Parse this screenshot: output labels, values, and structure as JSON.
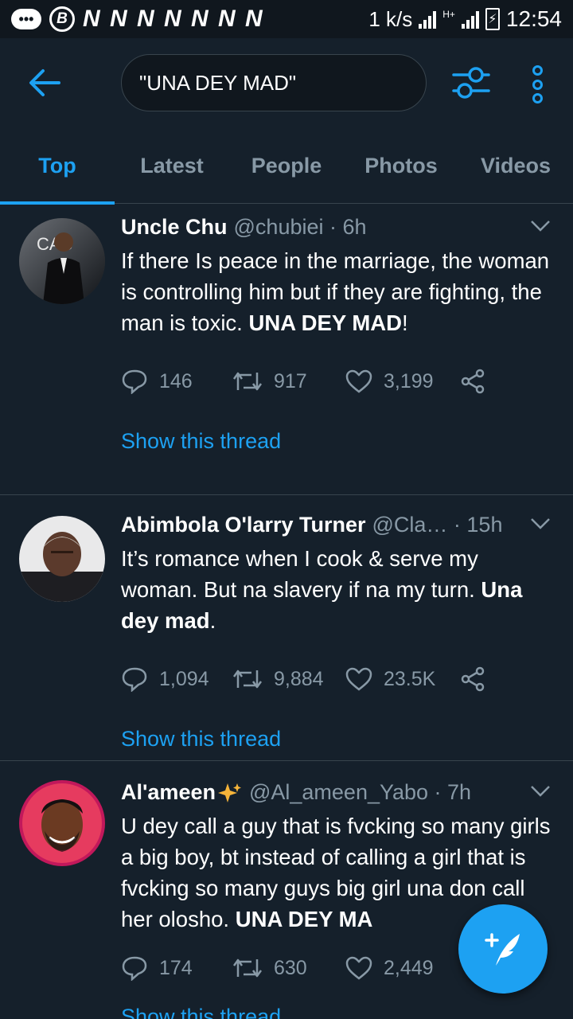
{
  "status_bar": {
    "notif_letter": "B",
    "n_icons": "N N N N N N N",
    "speed": "1 k/s",
    "network": "H+",
    "time": "12:54"
  },
  "header": {
    "search_value": "\"UNA DEY MAD\""
  },
  "tabs": [
    {
      "label": "Top",
      "active": true
    },
    {
      "label": "Latest",
      "active": false
    },
    {
      "label": "People",
      "active": false
    },
    {
      "label": "Photos",
      "active": false
    },
    {
      "label": "Videos",
      "active": false
    }
  ],
  "tweets": [
    {
      "name": "Uncle Chu",
      "handle": "@chubiei",
      "time": "6h",
      "text_before": "If there Is peace in the marriage, the woman is controlling him but if they are fighting, the man is toxic. ",
      "text_bold": "UNA DEY MAD",
      "text_after": "!",
      "replies": "146",
      "retweets": "917",
      "likes": "3,199",
      "thread_link": "Show this thread"
    },
    {
      "name": "Abimbola O'larry Turner",
      "handle": "@Cla…",
      "time": "15h",
      "text_before": "It’s romance when I cook & serve my woman. But na slavery if na my turn. ",
      "text_bold": "Una dey mad",
      "text_after": ".",
      "replies": "1,094",
      "retweets": "9,884",
      "likes": "23.5K",
      "thread_link": "Show this thread"
    },
    {
      "name": "Al'ameen",
      "handle": "@Al_ameen_Yabo",
      "time": "7h",
      "text_before": "U dey call a guy that is fvcking so many girls a big boy, bt instead of calling a girl that is fvcking so many guys big girl una don call her olosho. ",
      "text_bold": "UNA DEY MA",
      "text_after": "",
      "replies": "174",
      "retweets": "630",
      "likes": "2,449",
      "thread_link": "Show this thread"
    }
  ],
  "colors": {
    "background": "#15202b",
    "accent": "#1da1f2",
    "muted": "#8899a6",
    "divider": "#38444d"
  },
  "icons": {
    "back": "arrow-left-icon",
    "filter": "sliders-icon",
    "more": "vertical-ellipsis-icon",
    "reply": "speech-bubble-icon",
    "retweet": "retweet-icon",
    "like": "heart-icon",
    "share": "share-icon",
    "compose": "feather-plus-icon"
  }
}
